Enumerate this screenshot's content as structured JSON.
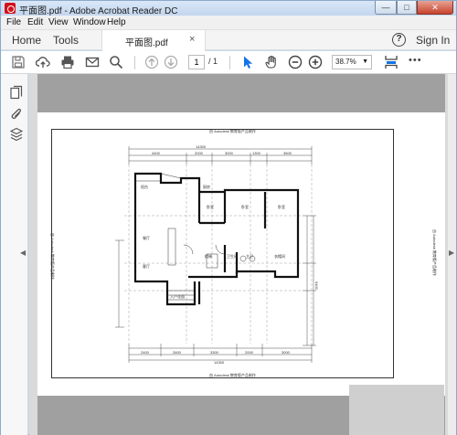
{
  "window": {
    "title": "平面图.pdf - Adobe Acrobat Reader DC",
    "minimize": "—",
    "maximize": "□",
    "close": "✕"
  },
  "menu": [
    "File",
    "Edit",
    "View",
    "Window",
    "Help"
  ],
  "nav": {
    "home": "Home",
    "tools": "Tools",
    "tab_label": "平面图.pdf",
    "tab_close": "×",
    "help": "?",
    "sign_in": "Sign In"
  },
  "toolbar": {
    "icons": [
      "save-icon",
      "upload-cloud-icon",
      "print-icon",
      "email-icon",
      "search-icon",
      "page-up-icon",
      "page-down-icon",
      "select-cursor-icon",
      "hand-tool-icon",
      "zoom-out-icon",
      "zoom-in-icon",
      "fit-page-icon",
      "more-icon"
    ],
    "page_current": "1",
    "page_total": "/ 1",
    "zoom": "38.7%",
    "more": "•••"
  },
  "colors": {
    "accent": "#1473e6",
    "close_button": "#c7432d",
    "acrobat_red": "#d4101a",
    "page_background": "#a0a0a0"
  },
  "plan": {
    "top_caption": "由 Autodesk 教育版产品制作",
    "bottom_caption": "由 Autodesk 教育版产品制作",
    "side_caption_left": "由 Autodesk 教育版产品制作",
    "side_caption_right": "由 Autodesk 教育版产品制作",
    "top_total": "14300",
    "bottom_total": "14300",
    "top_dims": [
      "4400",
      "2000",
      "3000",
      "1300",
      "3600"
    ],
    "bottom_dims": [
      "2400",
      "2600",
      "3300",
      "2000",
      "3000"
    ],
    "side_total": "9400",
    "rooms": [
      "阳台",
      "餐厅",
      "卧室",
      "卧室",
      "卧室",
      "客厅",
      "厨房",
      "卫生间",
      "主卫",
      "衣帽间",
      "入户花园",
      "楼梯"
    ]
  }
}
